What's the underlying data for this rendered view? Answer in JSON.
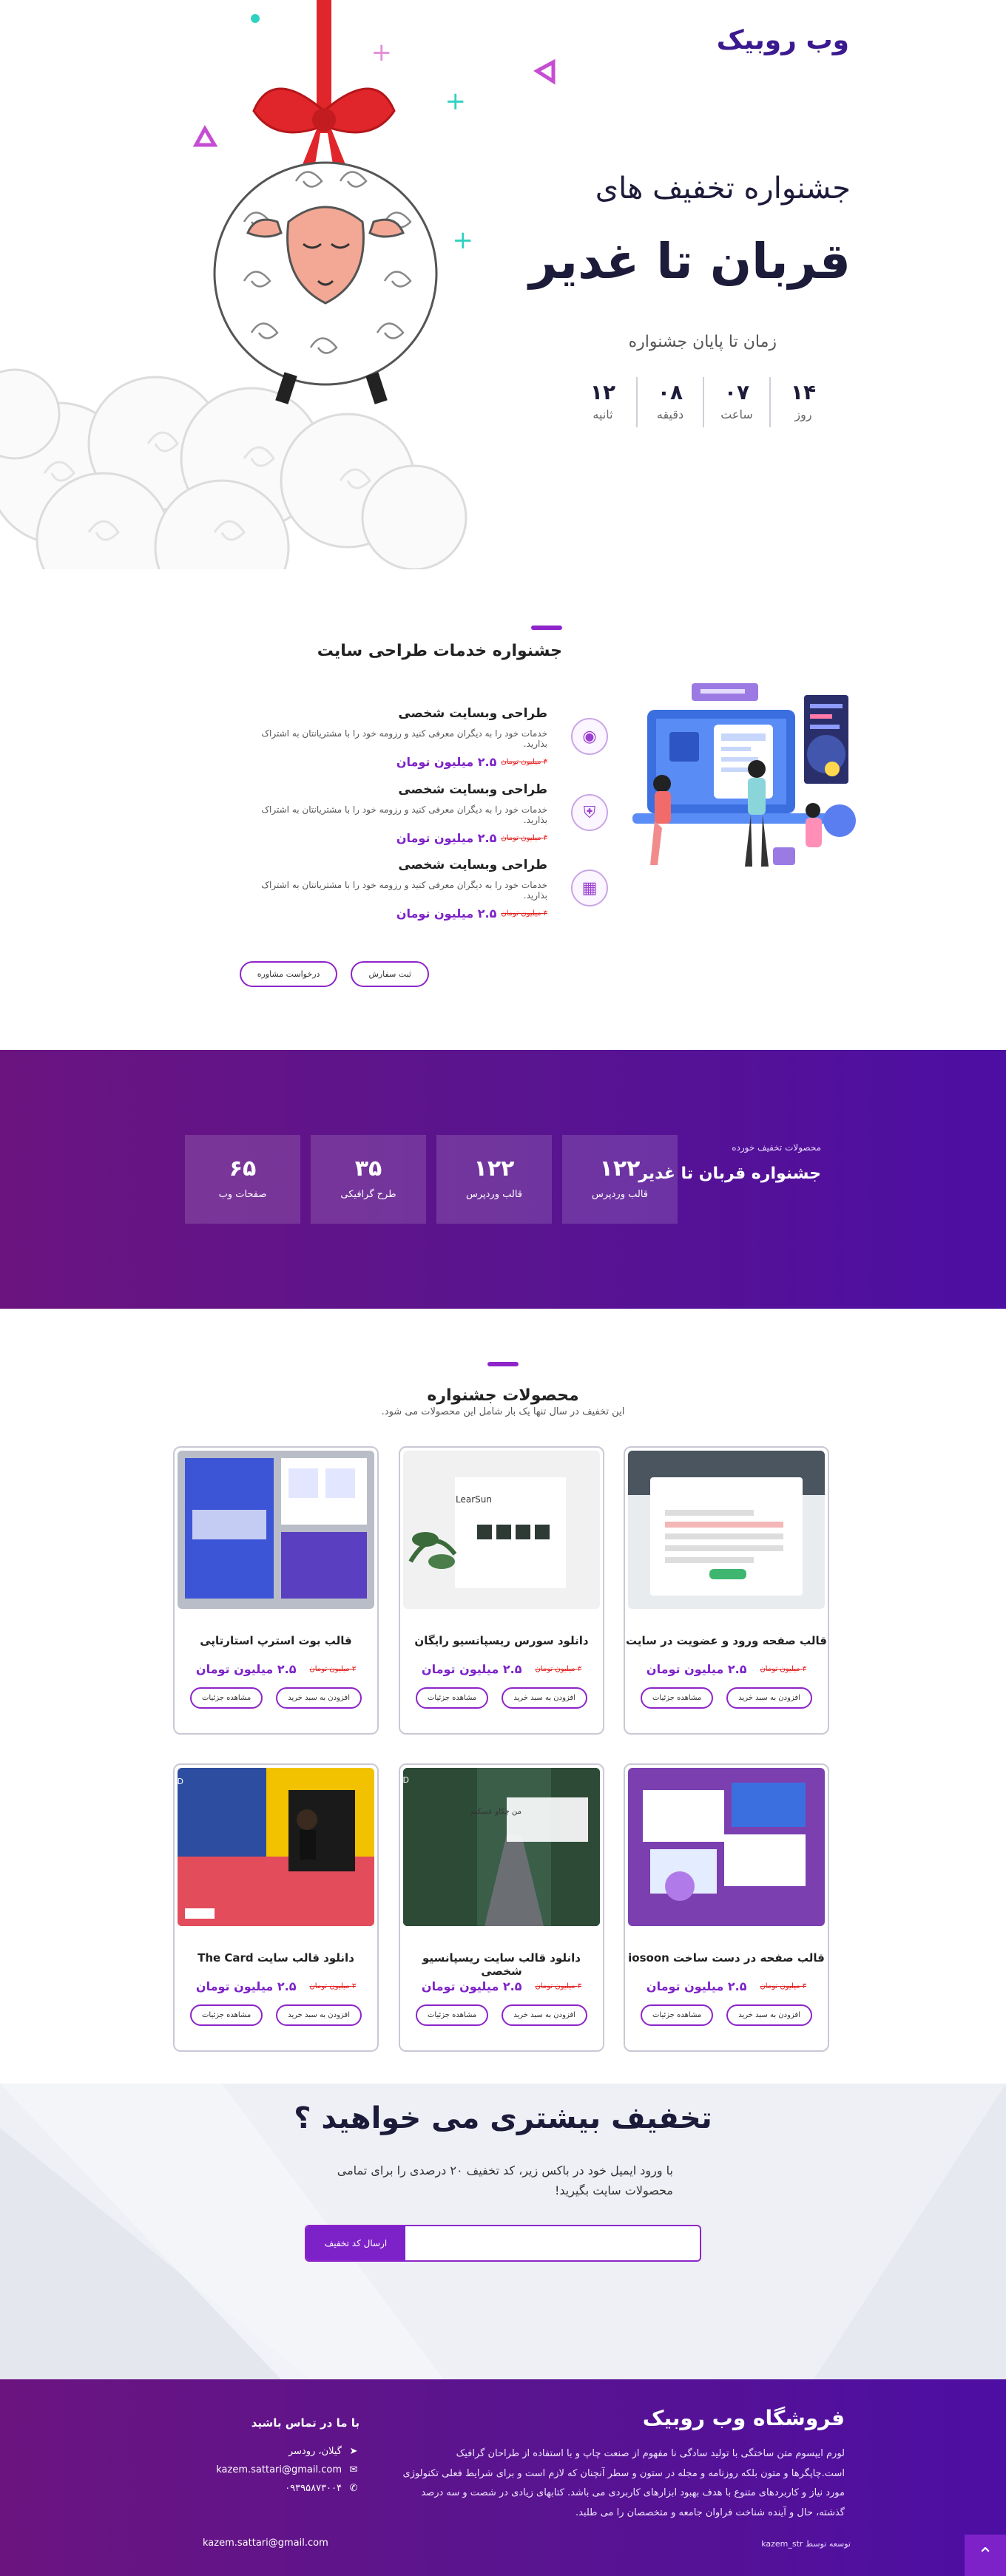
{
  "header": {
    "brand": "وب روبیک"
  },
  "hero": {
    "subtitle": "جشنواره تخفیف های",
    "title": "قربان تا غدیر",
    "countdown_title": "زمان تا پایان جشنواره",
    "countdown": [
      {
        "value": "۱۴",
        "label": "روز"
      },
      {
        "value": "۰۷",
        "label": "ساعت"
      },
      {
        "value": "۰۸",
        "label": "دقیقه"
      },
      {
        "value": "۱۲",
        "label": "ثانیه"
      }
    ]
  },
  "services": {
    "title": "جشنواره خدمات طراحی سایت",
    "items": [
      {
        "name": "طراحی وبسایت شخصی",
        "desc": "خدمات خود را به دیگران معرفی کنید و رزومه خود را با مشتریانتان به اشتراک بذارید.",
        "price": "۲.۵ میلیون تومان",
        "old_price": "۳ میلیون تومان",
        "icon": "fingerprint-icon"
      },
      {
        "name": "طراحی وبسایت شخصی",
        "desc": "خدمات خود را به دیگران معرفی کنید و رزومه خود را با مشتریانتان به اشتراک بذارید.",
        "price": "۲.۵ میلیون تومان",
        "old_price": "۳ میلیون تومان",
        "icon": "shield-icon"
      },
      {
        "name": "طراحی وبسایت شخصی",
        "desc": "خدمات خود را به دیگران معرفی کنید و رزومه خود را با مشتریانتان به اشتراک بذارید.",
        "price": "۲.۵ میلیون تومان",
        "old_price": "۳ میلیون تومان",
        "icon": "store-icon"
      }
    ],
    "request_btn": "درخواست مشاوره",
    "order_btn": "ثبت سفارش"
  },
  "stats": {
    "small": "محصولات تخفیف خورده",
    "title": "جشنواره قربان تا غدیر",
    "items": [
      {
        "value": "۱۲۲",
        "label": "قالب وردپرس"
      },
      {
        "value": "۱۲۲",
        "label": "قالب وردپرس"
      },
      {
        "value": "۳۵",
        "label": "طرح گرافیکی"
      },
      {
        "value": "۶۵",
        "label": "صفحات وب"
      }
    ]
  },
  "products": {
    "title": "محصولات جشنواره",
    "subtitle": "این تخفیف در سال تنها یک بار شامل این محصولات می شود.",
    "details_btn": "مشاهده جزئیات",
    "cart_btn": "افزودن به سبد خرید",
    "items": [
      {
        "name": "قالب صفحه ورود و عضویت در سایت",
        "price": "۲.۵ میلیون تومان",
        "old_price": "۳ میلیون تومان"
      },
      {
        "name": "دانلود سورس ریسپانسیو رایگان",
        "price": "۲.۵ میلیون تومان",
        "old_price": "۳ میلیون تومان"
      },
      {
        "name": "قالب بوت استرپ استارتاپی",
        "price": "۲.۵ میلیون تومان",
        "old_price": "۳ میلیون تومان"
      },
      {
        "name": "قالب صفحه در دست ساخت iosoon",
        "price": "۲.۵ میلیون تومان",
        "old_price": "۳ میلیون تومان"
      },
      {
        "name": "دانلود قالب سایت ریسپانسیو شخصی",
        "price": "۲.۵ میلیون تومان",
        "old_price": "۳ میلیون تومان"
      },
      {
        "name": "دانلود قالب سایت The Card",
        "price": "۲.۵ میلیون تومان",
        "old_price": "۳ میلیون تومان"
      }
    ],
    "thumb_texts": {
      "login": "وارد شوید",
      "learn": "LearSun",
      "card": "THE CARD",
      "person": "من چکاو عسکیم"
    }
  },
  "newsletter": {
    "title": "تخفیف بیشتری می خواهید ؟",
    "desc": "با ورود ایمیل خود در باکس زیر، کد تخفیف ۲۰ درصدی را برای تمامی محصولات سایت بگیرید!",
    "placeholder": "",
    "button": "ارسال کد تخفیف"
  },
  "footer": {
    "brand": "فروشگاه وب روبیک",
    "about": "لورم ایپسوم متن ساختگی با تولید سادگی نا مفهوم از صنعت چاپ و با استفاده از طراحان گرافیک است.چاپگرها و متون بلکه روزنامه و مجله در ستون و سطر آنچنان که لازم است و برای شرایط فعلی تکنولوژی مورد نیاز و کاربردهای متنوع با هدف بهبود ابزارهای کاربردی می باشد. کتابهای زیادی در شصت و سه درصد گذشته، حال و آینده شناخت فراوان جامعه و متخصصان را می طلبد.",
    "contact_title": "با ما در تماس باشید",
    "location": "گیلان، رودسر",
    "email": "kazem.sattari@gmail.com",
    "phone": "۰۹۳۹۵۸۷۳۰۰۴",
    "bottom_right": "توسعه توسط kazem_str",
    "bottom_left": "kazem.sattari@gmail.com"
  },
  "colors": {
    "brand": "#7d22c8",
    "dark": "#1d1b3a",
    "old_price": "#e21b1b"
  }
}
